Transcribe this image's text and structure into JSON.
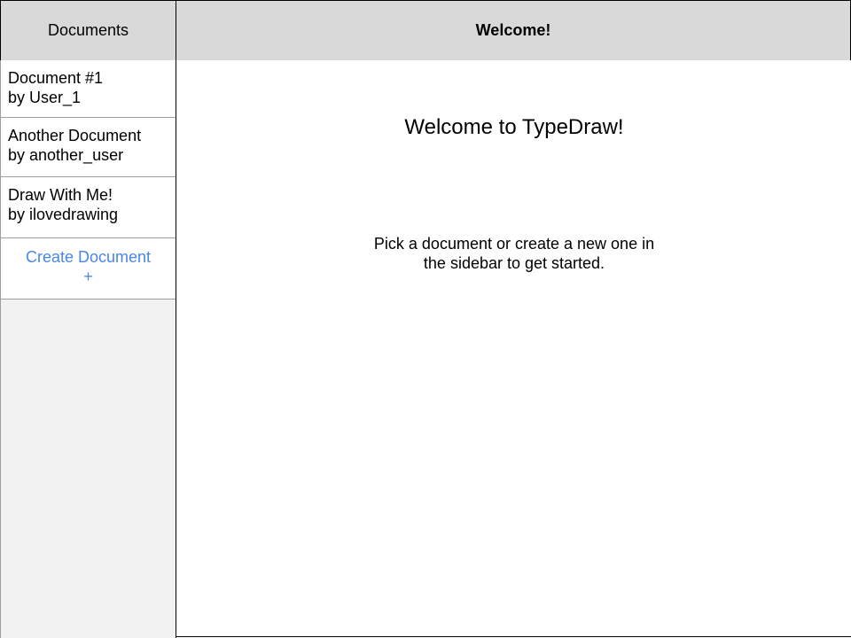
{
  "sidebar": {
    "header": "Documents",
    "documents": [
      {
        "title": "Document #1",
        "author": "by User_1"
      },
      {
        "title": "Another Document",
        "author": "by another_user"
      },
      {
        "title": "Draw With Me!",
        "author": "by ilovedrawing"
      }
    ],
    "create_label": "Create Document",
    "create_symbol": "+"
  },
  "main": {
    "header": "Welcome!",
    "title": "Welcome to TypeDraw!",
    "message": "Pick a document or create a new one in the sidebar to get started."
  }
}
